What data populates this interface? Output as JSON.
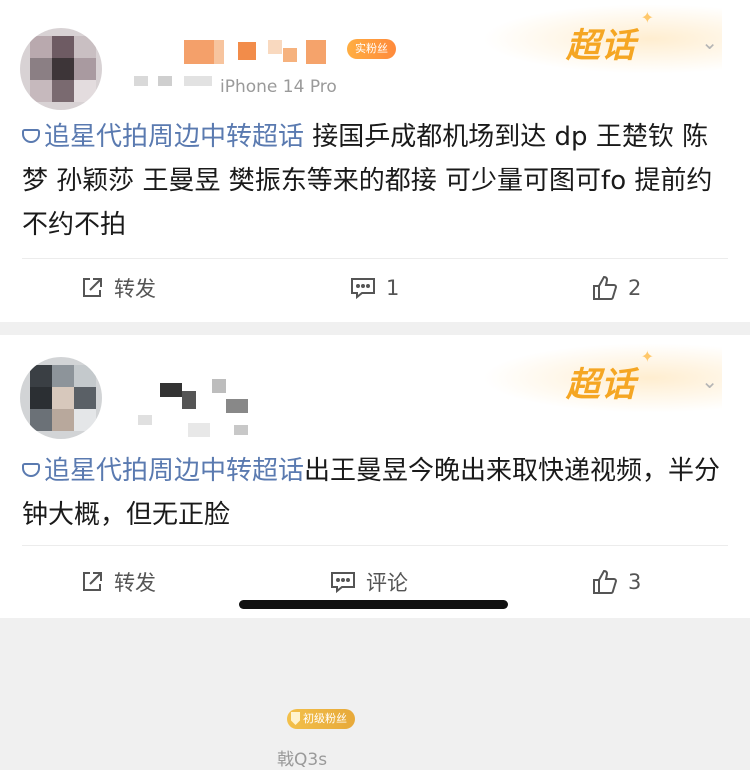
{
  "posts": [
    {
      "badge": "实粉丝",
      "source": "iPhone 14 Pro",
      "supertopic_label": "超话",
      "topic": "追星代拍周边中转超话",
      "text": " 接国乒成都机场到达 dp 王楚钦 陈梦 孙颖莎 王曼昱 樊振东等来的都接 可少量可图可fo 提前约 不约不拍",
      "actions": {
        "repost": "转发",
        "comment": "1",
        "like": "2"
      }
    },
    {
      "badge": "初级粉丝",
      "source": "戟Q3s",
      "supertopic_label": "超话",
      "topic": "追星代拍周边中转超话",
      "text": "出王曼昱今晚出来取快递视频，半分钟大概，但无正脸",
      "actions": {
        "repost": "转发",
        "comment": "评论",
        "like": "3"
      }
    }
  ],
  "colors": {
    "topic_link": "#5a7ab0",
    "supertopic": "#f5a623",
    "badge_1": "#ff9a3c",
    "badge_2": "#eab13f"
  },
  "icons": {
    "repost": "share-square-icon",
    "comment": "comment-icon",
    "like": "thumbs-up-icon",
    "more": "chevron-down-icon",
    "topic": "diamond-topic-icon"
  }
}
